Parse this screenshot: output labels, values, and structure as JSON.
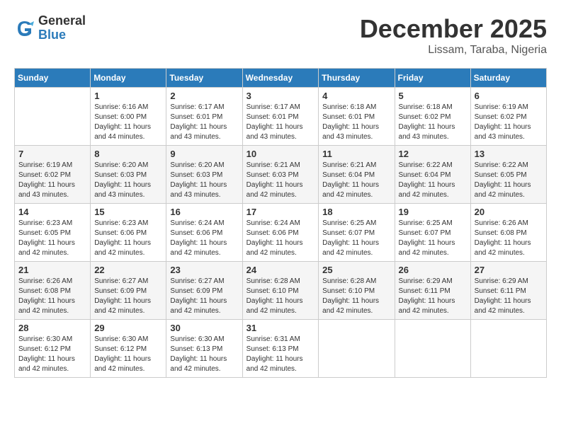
{
  "logo": {
    "general": "General",
    "blue": "Blue"
  },
  "title": "December 2025",
  "location": "Lissam, Taraba, Nigeria",
  "days_header": [
    "Sunday",
    "Monday",
    "Tuesday",
    "Wednesday",
    "Thursday",
    "Friday",
    "Saturday"
  ],
  "weeks": [
    [
      {
        "day": "",
        "info": ""
      },
      {
        "day": "1",
        "info": "Sunrise: 6:16 AM\nSunset: 6:00 PM\nDaylight: 11 hours\nand 44 minutes."
      },
      {
        "day": "2",
        "info": "Sunrise: 6:17 AM\nSunset: 6:01 PM\nDaylight: 11 hours\nand 43 minutes."
      },
      {
        "day": "3",
        "info": "Sunrise: 6:17 AM\nSunset: 6:01 PM\nDaylight: 11 hours\nand 43 minutes."
      },
      {
        "day": "4",
        "info": "Sunrise: 6:18 AM\nSunset: 6:01 PM\nDaylight: 11 hours\nand 43 minutes."
      },
      {
        "day": "5",
        "info": "Sunrise: 6:18 AM\nSunset: 6:02 PM\nDaylight: 11 hours\nand 43 minutes."
      },
      {
        "day": "6",
        "info": "Sunrise: 6:19 AM\nSunset: 6:02 PM\nDaylight: 11 hours\nand 43 minutes."
      }
    ],
    [
      {
        "day": "7",
        "info": "Sunrise: 6:19 AM\nSunset: 6:02 PM\nDaylight: 11 hours\nand 43 minutes."
      },
      {
        "day": "8",
        "info": "Sunrise: 6:20 AM\nSunset: 6:03 PM\nDaylight: 11 hours\nand 43 minutes."
      },
      {
        "day": "9",
        "info": "Sunrise: 6:20 AM\nSunset: 6:03 PM\nDaylight: 11 hours\nand 43 minutes."
      },
      {
        "day": "10",
        "info": "Sunrise: 6:21 AM\nSunset: 6:03 PM\nDaylight: 11 hours\nand 42 minutes."
      },
      {
        "day": "11",
        "info": "Sunrise: 6:21 AM\nSunset: 6:04 PM\nDaylight: 11 hours\nand 42 minutes."
      },
      {
        "day": "12",
        "info": "Sunrise: 6:22 AM\nSunset: 6:04 PM\nDaylight: 11 hours\nand 42 minutes."
      },
      {
        "day": "13",
        "info": "Sunrise: 6:22 AM\nSunset: 6:05 PM\nDaylight: 11 hours\nand 42 minutes."
      }
    ],
    [
      {
        "day": "14",
        "info": "Sunrise: 6:23 AM\nSunset: 6:05 PM\nDaylight: 11 hours\nand 42 minutes."
      },
      {
        "day": "15",
        "info": "Sunrise: 6:23 AM\nSunset: 6:06 PM\nDaylight: 11 hours\nand 42 minutes."
      },
      {
        "day": "16",
        "info": "Sunrise: 6:24 AM\nSunset: 6:06 PM\nDaylight: 11 hours\nand 42 minutes."
      },
      {
        "day": "17",
        "info": "Sunrise: 6:24 AM\nSunset: 6:06 PM\nDaylight: 11 hours\nand 42 minutes."
      },
      {
        "day": "18",
        "info": "Sunrise: 6:25 AM\nSunset: 6:07 PM\nDaylight: 11 hours\nand 42 minutes."
      },
      {
        "day": "19",
        "info": "Sunrise: 6:25 AM\nSunset: 6:07 PM\nDaylight: 11 hours\nand 42 minutes."
      },
      {
        "day": "20",
        "info": "Sunrise: 6:26 AM\nSunset: 6:08 PM\nDaylight: 11 hours\nand 42 minutes."
      }
    ],
    [
      {
        "day": "21",
        "info": "Sunrise: 6:26 AM\nSunset: 6:08 PM\nDaylight: 11 hours\nand 42 minutes."
      },
      {
        "day": "22",
        "info": "Sunrise: 6:27 AM\nSunset: 6:09 PM\nDaylight: 11 hours\nand 42 minutes."
      },
      {
        "day": "23",
        "info": "Sunrise: 6:27 AM\nSunset: 6:09 PM\nDaylight: 11 hours\nand 42 minutes."
      },
      {
        "day": "24",
        "info": "Sunrise: 6:28 AM\nSunset: 6:10 PM\nDaylight: 11 hours\nand 42 minutes."
      },
      {
        "day": "25",
        "info": "Sunrise: 6:28 AM\nSunset: 6:10 PM\nDaylight: 11 hours\nand 42 minutes."
      },
      {
        "day": "26",
        "info": "Sunrise: 6:29 AM\nSunset: 6:11 PM\nDaylight: 11 hours\nand 42 minutes."
      },
      {
        "day": "27",
        "info": "Sunrise: 6:29 AM\nSunset: 6:11 PM\nDaylight: 11 hours\nand 42 minutes."
      }
    ],
    [
      {
        "day": "28",
        "info": "Sunrise: 6:30 AM\nSunset: 6:12 PM\nDaylight: 11 hours\nand 42 minutes."
      },
      {
        "day": "29",
        "info": "Sunrise: 6:30 AM\nSunset: 6:12 PM\nDaylight: 11 hours\nand 42 minutes."
      },
      {
        "day": "30",
        "info": "Sunrise: 6:30 AM\nSunset: 6:13 PM\nDaylight: 11 hours\nand 42 minutes."
      },
      {
        "day": "31",
        "info": "Sunrise: 6:31 AM\nSunset: 6:13 PM\nDaylight: 11 hours\nand 42 minutes."
      },
      {
        "day": "",
        "info": ""
      },
      {
        "day": "",
        "info": ""
      },
      {
        "day": "",
        "info": ""
      }
    ]
  ]
}
